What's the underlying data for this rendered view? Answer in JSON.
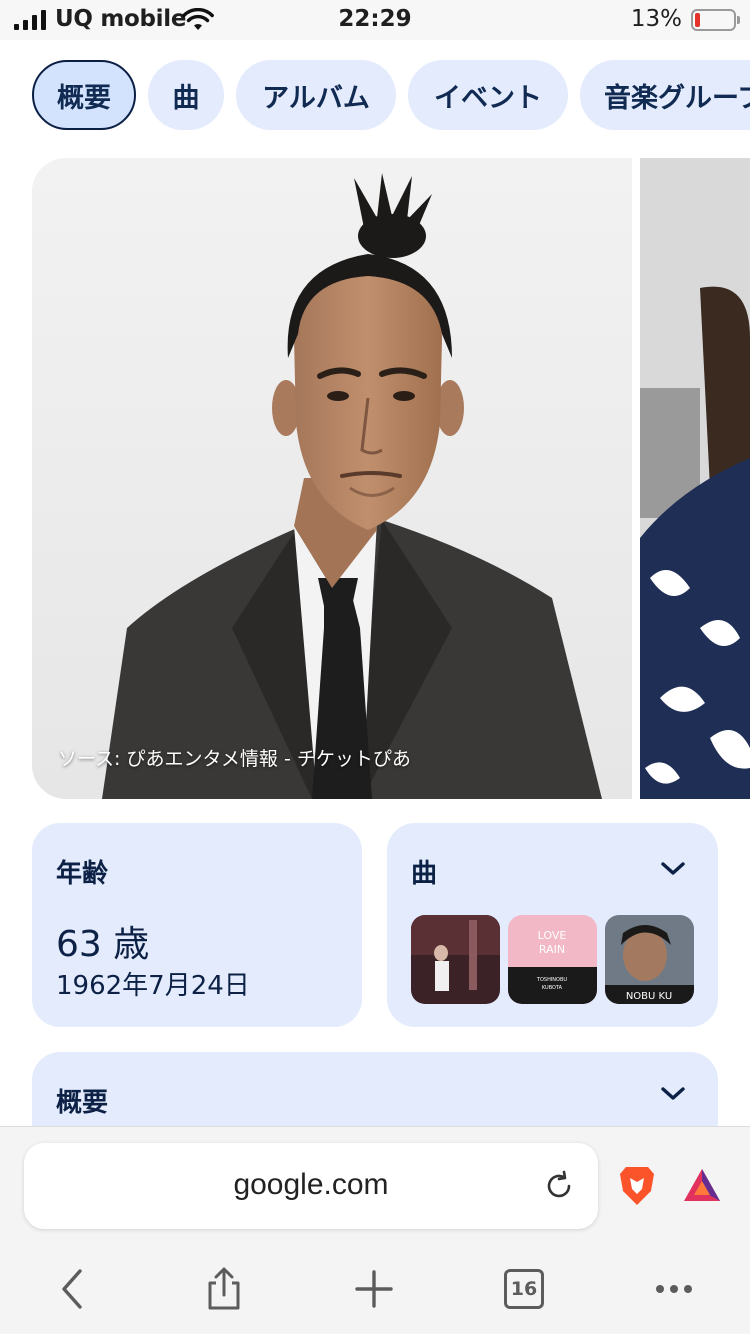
{
  "status": {
    "carrier": "UQ mobile",
    "time": "22:29",
    "battery_percent_label": "13%",
    "battery_level": 0.13,
    "battery_color": "#e3322c"
  },
  "chips": [
    {
      "label": "概要",
      "active": true
    },
    {
      "label": "曲",
      "active": false
    },
    {
      "label": "アルバム",
      "active": false
    },
    {
      "label": "イベント",
      "active": false
    },
    {
      "label": "音楽グループ",
      "active": false
    }
  ],
  "photo": {
    "source": "ソース: ぴあエンタメ情報 - チケットぴあ"
  },
  "age_card": {
    "title": "年齢",
    "age": "63 歳",
    "birth_date": "1962年7月24日"
  },
  "songs_card": {
    "title": "曲",
    "expand_icon": "chevron-down-icon"
  },
  "overview_card": {
    "title": "概要",
    "expand_icon": "chevron-down-icon"
  },
  "browser": {
    "url": "google.com",
    "tab_count": "16",
    "icons": [
      "reload-icon",
      "brave-shields-icon",
      "bat-rewards-icon",
      "back-icon",
      "share-icon",
      "new-tab-icon",
      "tabs-icon",
      "more-icon"
    ]
  },
  "colors": {
    "accent": "#d3e3fd",
    "card_bg": "#e3ebfc",
    "text_dark": "#0c2145",
    "brave_orange": "#fb542b"
  }
}
